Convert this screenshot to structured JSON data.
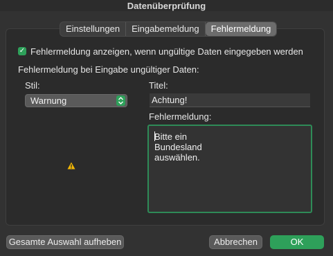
{
  "window": {
    "title": "Datenüberprüfung"
  },
  "tabs": [
    {
      "label": "Einstellungen",
      "active": false
    },
    {
      "label": "Eingabemeldung",
      "active": false
    },
    {
      "label": "Fehlermeldung",
      "active": true
    }
  ],
  "error_alert": {
    "show_checkbox_label": "Fehlermeldung anzeigen, wenn ungültige Daten eingegeben werden",
    "show_checked": true,
    "section_label": "Fehlermeldung bei Eingabe ungültiger Daten:",
    "style_label": "Stil:",
    "style_value": "Warnung",
    "style_icon": "warning-icon",
    "title_label": "Titel:",
    "title_value": "Achtung!",
    "message_label": "Fehlermeldung:",
    "message_value": "Bitte ein Bundesland auswählen."
  },
  "footer": {
    "clear_all_label": "Gesamte Auswahl aufheben",
    "cancel_label": "Abbrechen",
    "ok_label": "OK"
  },
  "colors": {
    "accent": "#2ea05a",
    "warning": "#f2b705",
    "background": "#323232"
  }
}
